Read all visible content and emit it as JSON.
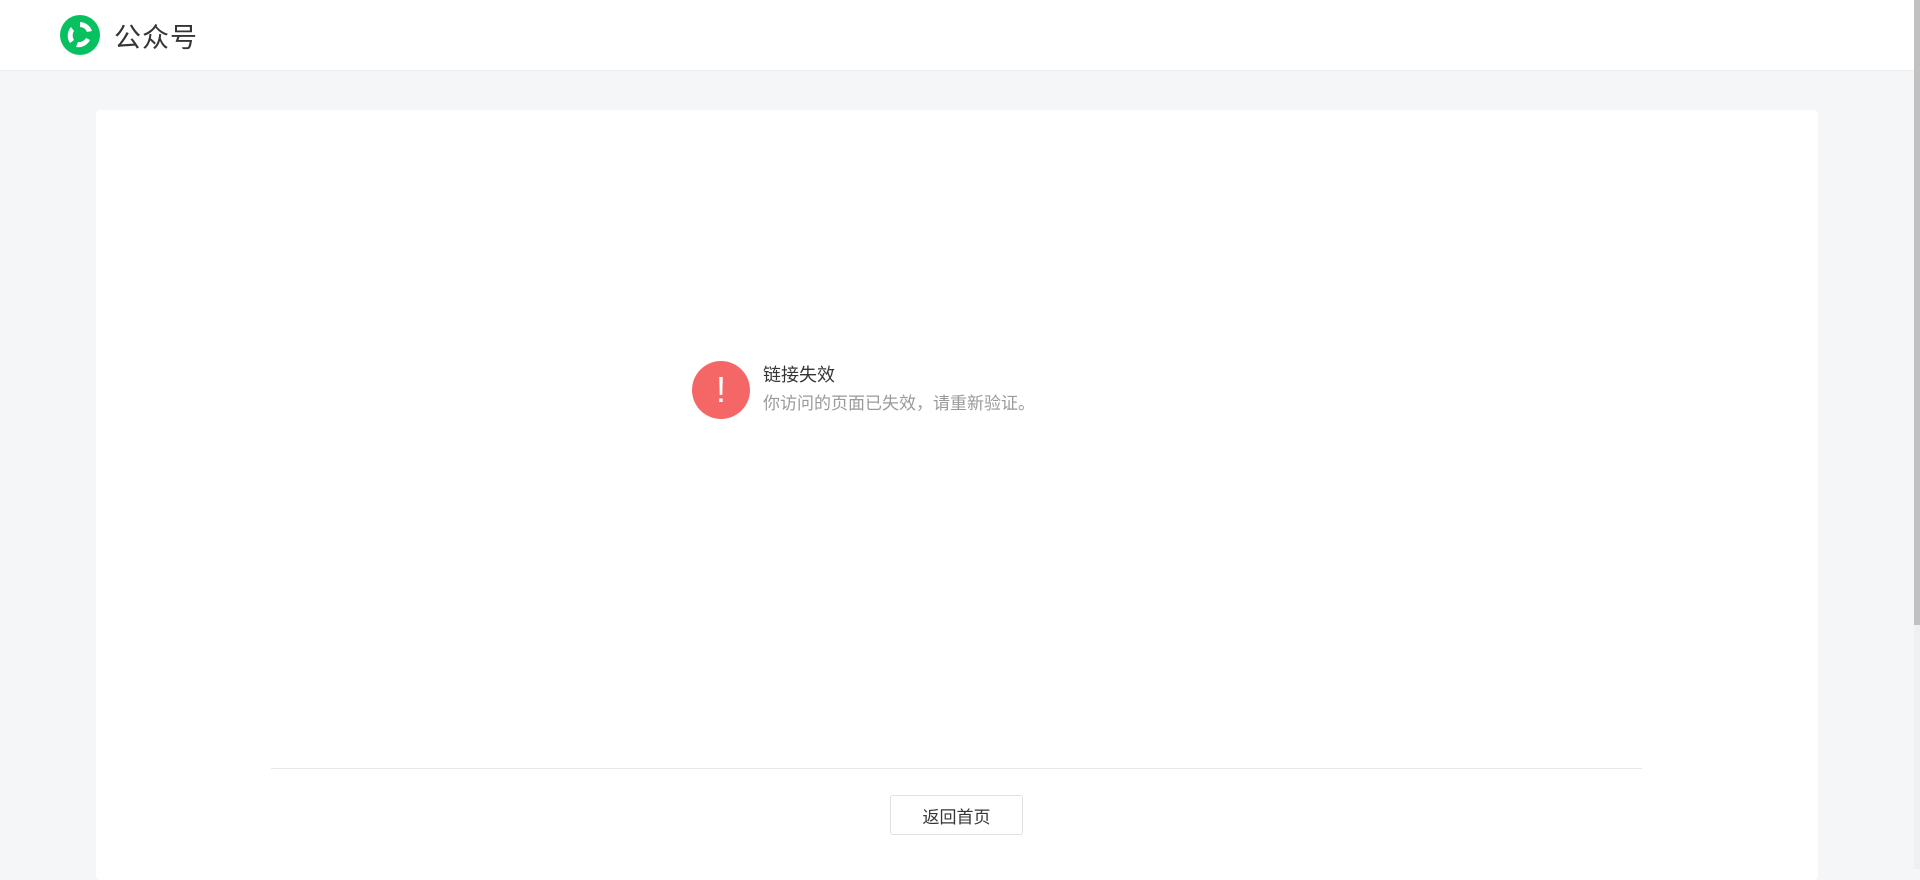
{
  "header": {
    "logo_icon": "wechat-official-account-logo-icon",
    "brand_name": "公众号",
    "brand_color": "#07c160"
  },
  "message": {
    "icon": "exclamation-icon",
    "icon_glyph": "!",
    "icon_color": "#f56767",
    "title": "链接失效",
    "description": "你访问的页面已失效，请重新验证。"
  },
  "footer": {
    "back_button_label": "返回首页"
  }
}
